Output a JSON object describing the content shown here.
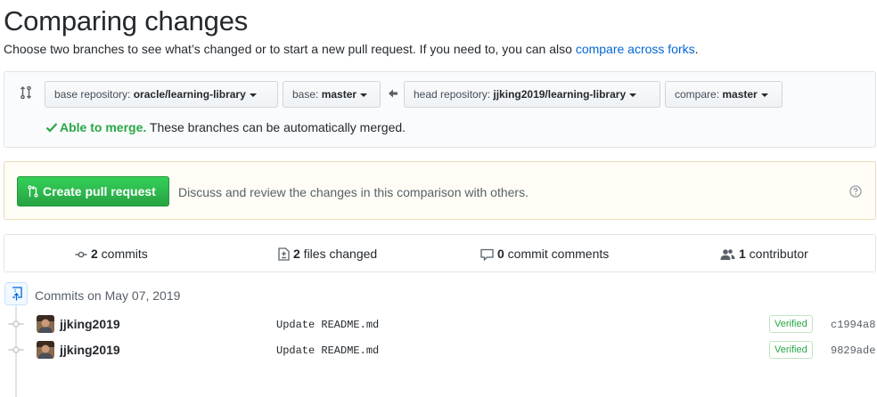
{
  "header": {
    "title": "Comparing changes",
    "subtitle": "Choose two branches to see what’s changed or to start a new pull request. If you need to, you can also ",
    "compare_link": "compare across forks",
    "subtitle_end": "."
  },
  "range": {
    "base_repo_label": "base repository: ",
    "base_repo_value": "oracle/learning-library",
    "base_label": "base: ",
    "base_value": "master",
    "head_repo_label": "head repository: ",
    "head_repo_value": "jjking2019/learning-library",
    "compare_label": "compare: ",
    "compare_value": "master",
    "merge_ok": "Able to merge.",
    "merge_text": " These branches can be automatically merged."
  },
  "pull_request": {
    "button_label": "Create pull request",
    "description": "Discuss and review the changes in this comparison with others."
  },
  "stats": {
    "commits_count": "2",
    "commits_label": " commits",
    "files_count": "2",
    "files_label": " files changed",
    "comments_count": "0",
    "comments_label": " commit comments",
    "contributors_count": "1",
    "contributors_label": " contributor"
  },
  "commits": {
    "group_title": "Commits on May 07, 2019",
    "items": [
      {
        "author": "jjking2019",
        "message": "Update README.md",
        "badge": "Verified",
        "sha": "c1994a8"
      },
      {
        "author": "jjking2019",
        "message": "Update README.md",
        "badge": "Verified",
        "sha": "9829ade"
      }
    ]
  },
  "colors": {
    "link": "#0366d6",
    "success": "#28a745",
    "primary_button": "#2cbe4e",
    "notice_bg": "#fffdf5"
  }
}
